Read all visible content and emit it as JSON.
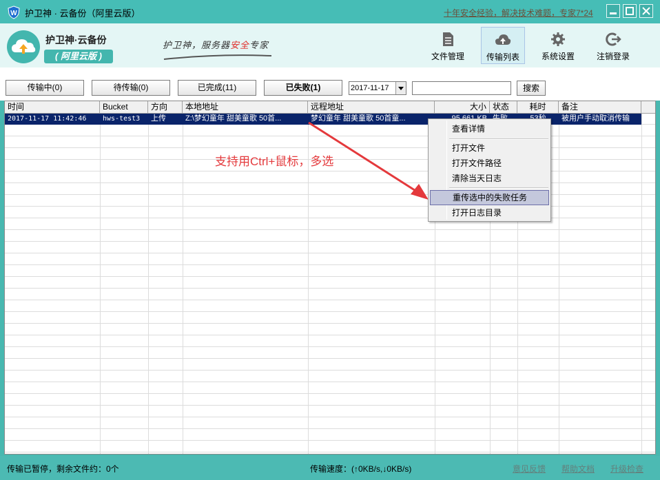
{
  "window": {
    "title": "护卫神 · 云备份（阿里云版）",
    "slogan": "十年安全经验，解决技术难题，专家7*24"
  },
  "brand": {
    "name": "护卫神·云备份",
    "edition": "( 阿里云版 )",
    "tagline_prefix": "护卫神，服务器",
    "tagline_highlight": "安全",
    "tagline_suffix": "专家"
  },
  "nav": [
    {
      "label": "文件管理",
      "icon": "document-icon",
      "active": false
    },
    {
      "label": "传输列表",
      "icon": "cloud-upload-icon",
      "active": true
    },
    {
      "label": "系统设置",
      "icon": "gear-icon",
      "active": false
    },
    {
      "label": "注销登录",
      "icon": "logout-icon",
      "active": false
    }
  ],
  "toolbar": {
    "tabs": [
      {
        "label": "传输中(0)"
      },
      {
        "label": "待传输(0)"
      },
      {
        "label": "已完成(11)"
      },
      {
        "label": "已失败(1)"
      }
    ],
    "date_value": "2017-11-17",
    "search_value": "",
    "search_label": "搜索"
  },
  "table": {
    "columns": [
      "时间",
      "Bucket",
      "方向",
      "本地地址",
      "远程地址",
      "大小",
      "状态",
      "耗时",
      "备注"
    ],
    "rows": [
      {
        "time": "2017-11-17 11:42:46",
        "bucket": "hws-test3",
        "direction": "上传",
        "local": "Z:\\梦幻童年 甜美童歌 50首...",
        "remote": "梦幻童年 甜美童歌 50首童...",
        "size": "95,661 KB",
        "status": "失败",
        "duration": "53秒",
        "note": "被用户手动取消传输"
      }
    ]
  },
  "annotation": "支持用Ctrl+鼠标，多选",
  "context_menu": {
    "items": [
      "查看详情",
      "打开文件",
      "打开文件路径",
      "清除当天日志",
      "重传选中的失败任务",
      "打开日志目录"
    ]
  },
  "status": {
    "left": "传输已暂停，剩余文件约：0个",
    "speed": "传输速度：(↑0KB/s,↓0KB/s)",
    "links": [
      "意见反馈",
      "帮助文档",
      "升级检查"
    ]
  },
  "colors": {
    "teal": "#46bdb6",
    "selection": "#0a246a",
    "annotation_red": "#e4393c"
  }
}
